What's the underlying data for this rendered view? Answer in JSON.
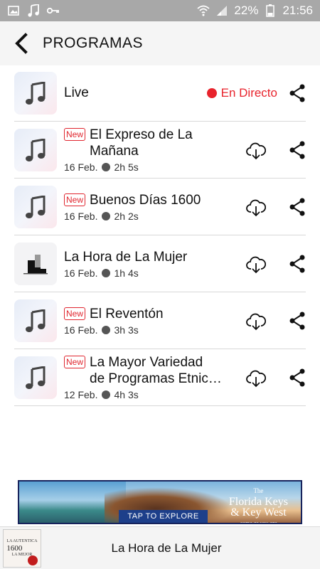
{
  "status_bar": {
    "left_icons": [
      "image-icon",
      "music-note-icon",
      "key-icon"
    ],
    "battery": "22%",
    "time": "21:56"
  },
  "app_bar": {
    "title": "PROGRAMAS"
  },
  "live": {
    "title": "Live",
    "status": "En Directo"
  },
  "programs": [
    {
      "badge": "New",
      "title_line1": "El Expreso de La",
      "title_line2": "Mañana",
      "date": "16 Feb.",
      "duration": "2h 5s",
      "thumb": "music-note-icon"
    },
    {
      "badge": "New",
      "title_line1": "Buenos Días 1600",
      "title_line2": "",
      "date": "16 Feb.",
      "duration": "2h 2s",
      "thumb": "music-note-icon"
    },
    {
      "badge": "",
      "title_line1": "La Hora de La Mujer",
      "title_line2": "",
      "date": "16 Feb.",
      "duration": "1h 4s",
      "thumb": "station-logo"
    },
    {
      "badge": "New",
      "title_line1": "El Reventón",
      "title_line2": "",
      "date": "16 Feb.",
      "duration": "3h 3s",
      "thumb": "music-note-icon"
    },
    {
      "badge": "New",
      "title_line1": "La Mayor Variedad",
      "title_line2": "de Programas Etnic…",
      "date": "12 Feb.",
      "duration": "4h 3s",
      "thumb": "music-note-icon"
    }
  ],
  "ad": {
    "cta": "TAP TO EXPLORE",
    "brand_line1": "The",
    "brand_line2": "Florida Keys",
    "brand_line3": "& Key West",
    "brand_tagline": "come as you are"
  },
  "player": {
    "title": "La Hora de La Mujer",
    "logo_line1": "LA AUTENTICA",
    "logo_num": "1600",
    "logo_line2": "LA MEJOR"
  },
  "colors": {
    "live_red": "#e8232c",
    "badge_red": "#e0252e",
    "status_bar": "#a8a8a8"
  }
}
